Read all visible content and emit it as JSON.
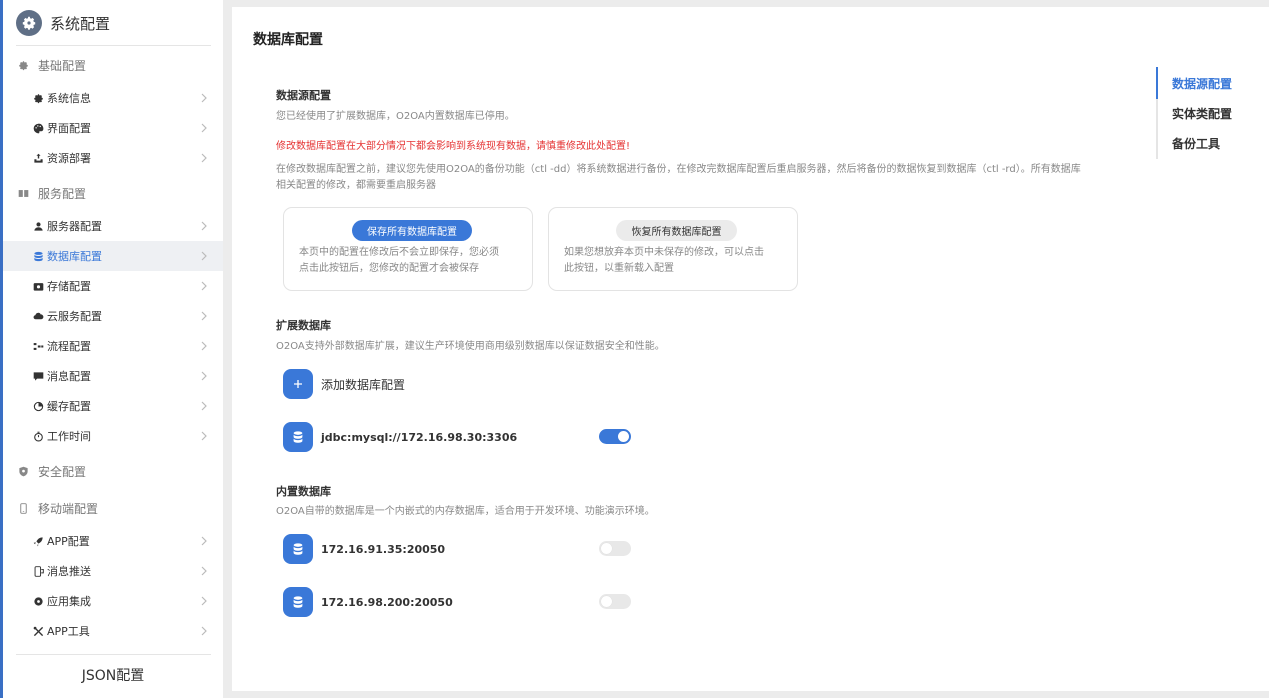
{
  "sidebar": {
    "title": "系统配置",
    "sections": [
      {
        "label": "基础配置",
        "icon": "gear-icon"
      },
      {
        "label": "服务配置",
        "icon": "server-icon"
      },
      {
        "label": "安全配置",
        "icon": "shield-icon"
      },
      {
        "label": "移动端配置",
        "icon": "mobile-icon"
      }
    ],
    "items": [
      {
        "label": "系统信息",
        "icon": "gear-icon"
      },
      {
        "label": "界面配置",
        "icon": "palette-icon"
      },
      {
        "label": "资源部署",
        "icon": "deploy-icon"
      },
      {
        "label": "服务器配置",
        "icon": "server-user-icon"
      },
      {
        "label": "数据库配置",
        "icon": "database-icon",
        "active": true
      },
      {
        "label": "存储配置",
        "icon": "storage-icon"
      },
      {
        "label": "云服务配置",
        "icon": "cloud-icon"
      },
      {
        "label": "流程配置",
        "icon": "flow-icon"
      },
      {
        "label": "消息配置",
        "icon": "message-icon"
      },
      {
        "label": "缓存配置",
        "icon": "pie-icon"
      },
      {
        "label": "工作时间",
        "icon": "stopwatch-icon"
      },
      {
        "label": "APP配置",
        "icon": "rocket-icon"
      },
      {
        "label": "消息推送",
        "icon": "push-icon"
      },
      {
        "label": "应用集成",
        "icon": "circle-icon"
      },
      {
        "label": "APP工具",
        "icon": "tools-icon"
      }
    ],
    "json_label": "JSON配置"
  },
  "main": {
    "title": "数据库配置",
    "datasource": {
      "heading": "数据源配置",
      "info": "您已经使用了扩展数据库，O2OA内置数据库已停用。",
      "warning": "修改数据库配置在大部分情况下都会影响到系统现有数据，请慎重修改此处配置!",
      "desc_line1": "在修改数据库配置之前，建议您先使用O2OA的备份功能（ctl -dd）将系统数据进行备份，在修改完数据库配置后重启服务器，然后将备份的数据恢复到数据库（ctl -rd）。所有数据库",
      "desc_line2": "相关配置的修改，都需要重启服务器",
      "save_card": {
        "button": "保存所有数据库配置",
        "line1": "本页中的配置在修改后不会立即保存，您必须",
        "line2": "点击此按钮后，您修改的配置才会被保存"
      },
      "restore_card": {
        "button": "恢复所有数据库配置",
        "line1": "如果您想放弃本页中未保存的修改，可以点击",
        "line2": "此按钮，以重新载入配置"
      }
    },
    "external": {
      "heading": "扩展数据库",
      "desc": "O2OA支持外部数据库扩展，建议生产环境使用商用级别数据库以保证数据安全和性能。",
      "add_label": "添加数据库配置",
      "entries": [
        {
          "name": "jdbc:mysql://172.16.98.30:3306",
          "enabled": true
        }
      ]
    },
    "builtin": {
      "heading": "内置数据库",
      "desc": "O2OA自带的数据库是一个内嵌式的内存数据库，适合用于开发环境、功能演示环境。",
      "entries": [
        {
          "name": "172.16.91.35:20050",
          "enabled": false
        },
        {
          "name": "172.16.98.200:20050",
          "enabled": false
        }
      ]
    }
  },
  "anchors": {
    "items": [
      "数据源配置",
      "实体类配置",
      "备份工具"
    ],
    "active_index": 0
  },
  "colors": {
    "accent": "#3a78d8",
    "warning": "#e53333",
    "sidebar_active_bg": "#eef0f3"
  }
}
